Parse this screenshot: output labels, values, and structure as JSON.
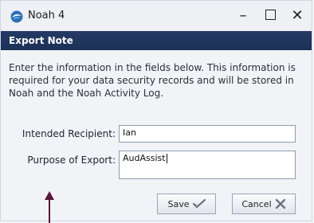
{
  "window": {
    "title": "Noah 4",
    "app_icon": "noah-logo-icon",
    "controls": {
      "minimize": "–",
      "maximize": "maximize-icon",
      "close": "✕"
    }
  },
  "dialog": {
    "header": "Export Note",
    "instructions": "Enter the information in the fields below. This information is required for your data security records and will be stored in Noah and the Noah Activity Log.",
    "fields": {
      "recipient": {
        "label": "Intended Recipient:",
        "value": "Ian"
      },
      "purpose": {
        "label": "Purpose of Export:",
        "value": "AudAssist"
      }
    },
    "buttons": {
      "save": {
        "label": "Save",
        "icon": "checkmark-icon"
      },
      "cancel": {
        "label": "Cancel",
        "icon": "cancel-x-icon"
      }
    }
  },
  "colors": {
    "header_bg": "#1f3359",
    "arrow": "#5a1838"
  }
}
